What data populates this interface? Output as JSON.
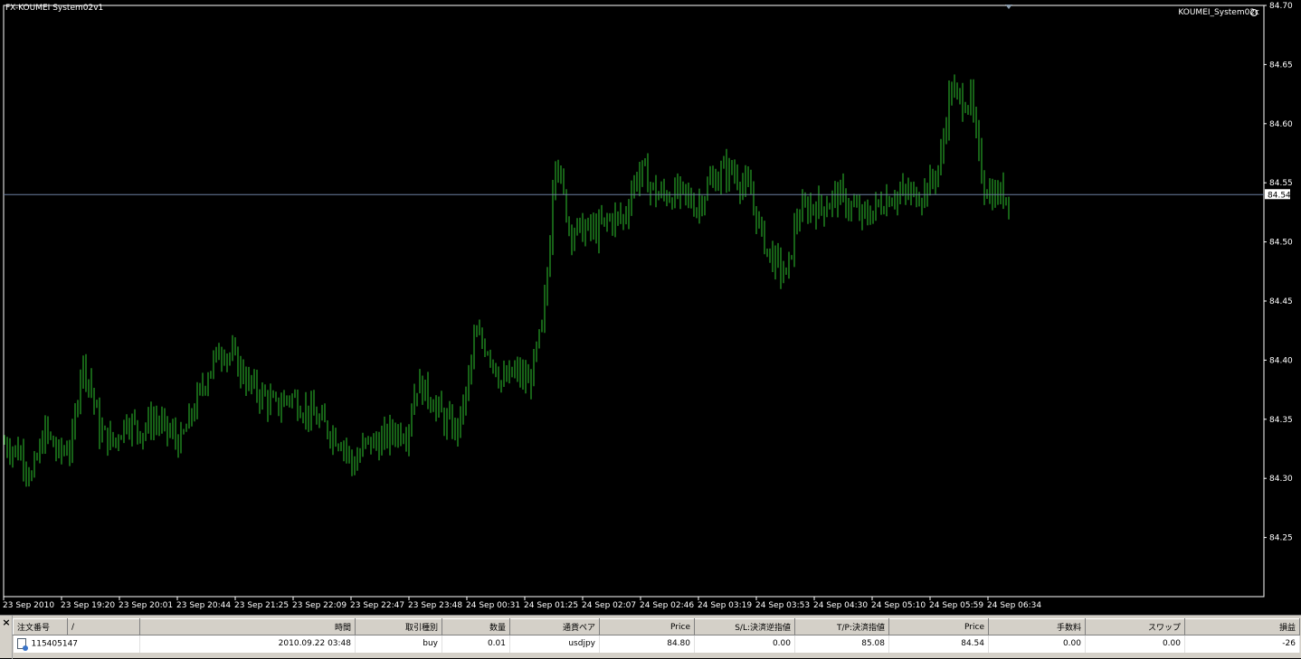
{
  "chart": {
    "title": "FX-KOUMEI System02v1",
    "indicator_label": "KOUMEI_System02c",
    "current_price_label": "84.54",
    "colors": {
      "bars": "#2ec52e",
      "axis": "#ffffff",
      "price_line": "#6c7f9f",
      "background": "#000000"
    }
  },
  "chart_data": {
    "type": "ohlc-bar",
    "symbol_hint": "usdjpy",
    "x_tick_labels": [
      "23 Sep 2010",
      "23 Sep 19:20",
      "23 Sep 20:01",
      "23 Sep 20:44",
      "23 Sep 21:25",
      "23 Sep 22:09",
      "23 Sep 22:47",
      "23 Sep 23:48",
      "24 Sep 00:31",
      "24 Sep 01:25",
      "24 Sep 02:07",
      "24 Sep 02:46",
      "24 Sep 03:19",
      "24 Sep 03:53",
      "24 Sep 04:30",
      "24 Sep 05:10",
      "24 Sep 05:59",
      "24 Sep 06:34"
    ],
    "y_tick_labels": [
      "84.70",
      "84.65",
      "84.60",
      "84.55",
      "84.50",
      "84.45",
      "84.40",
      "84.35",
      "84.30",
      "84.25"
    ],
    "ylim": [
      84.2,
      84.7
    ],
    "current_price": 84.54,
    "price_path": [
      [
        0,
        84.33
      ],
      [
        20,
        84.32
      ],
      [
        30,
        84.3
      ],
      [
        45,
        84.34
      ],
      [
        60,
        84.32
      ],
      [
        75,
        84.33
      ],
      [
        85,
        84.4
      ],
      [
        95,
        84.38
      ],
      [
        105,
        84.34
      ],
      [
        120,
        84.33
      ],
      [
        135,
        84.35
      ],
      [
        150,
        84.34
      ],
      [
        165,
        84.35
      ],
      [
        180,
        84.34
      ],
      [
        195,
        84.33
      ],
      [
        210,
        84.36
      ],
      [
        225,
        84.39
      ],
      [
        240,
        84.41
      ],
      [
        255,
        84.4
      ],
      [
        270,
        84.38
      ],
      [
        285,
        84.37
      ],
      [
        300,
        84.36
      ],
      [
        315,
        84.37
      ],
      [
        330,
        84.36
      ],
      [
        345,
        84.35
      ],
      [
        360,
        84.34
      ],
      [
        375,
        84.33
      ],
      [
        385,
        84.31
      ],
      [
        400,
        84.33
      ],
      [
        415,
        84.33
      ],
      [
        430,
        84.34
      ],
      [
        445,
        84.34
      ],
      [
        455,
        84.38
      ],
      [
        470,
        84.37
      ],
      [
        485,
        84.35
      ],
      [
        500,
        84.34
      ],
      [
        510,
        84.37
      ],
      [
        520,
        84.42
      ],
      [
        535,
        84.41
      ],
      [
        550,
        84.38
      ],
      [
        565,
        84.39
      ],
      [
        580,
        84.38
      ],
      [
        595,
        84.43
      ],
      [
        602,
        84.49
      ],
      [
        608,
        84.58
      ],
      [
        615,
        84.55
      ],
      [
        625,
        84.51
      ],
      [
        640,
        84.51
      ],
      [
        655,
        84.51
      ],
      [
        670,
        84.52
      ],
      [
        685,
        84.52
      ],
      [
        695,
        84.55
      ],
      [
        705,
        84.56
      ],
      [
        720,
        84.54
      ],
      [
        735,
        84.54
      ],
      [
        750,
        84.54
      ],
      [
        765,
        84.53
      ],
      [
        780,
        84.55
      ],
      [
        795,
        84.56
      ],
      [
        805,
        84.56
      ],
      [
        815,
        84.55
      ],
      [
        825,
        84.54
      ],
      [
        835,
        84.51
      ],
      [
        845,
        84.49
      ],
      [
        855,
        84.48
      ],
      [
        865,
        84.47
      ],
      [
        875,
        84.52
      ],
      [
        890,
        84.53
      ],
      [
        905,
        84.53
      ],
      [
        920,
        84.54
      ],
      [
        935,
        84.53
      ],
      [
        950,
        84.52
      ],
      [
        965,
        84.53
      ],
      [
        980,
        84.54
      ],
      [
        995,
        84.54
      ],
      [
        1010,
        84.54
      ],
      [
        1025,
        84.55
      ],
      [
        1035,
        84.57
      ],
      [
        1045,
        84.63
      ],
      [
        1055,
        84.62
      ],
      [
        1068,
        84.62
      ],
      [
        1075,
        84.58
      ],
      [
        1082,
        84.55
      ],
      [
        1090,
        84.54
      ],
      [
        1100,
        84.54
      ],
      [
        1112,
        84.54
      ]
    ]
  },
  "orders_table": {
    "columns": [
      "注文番号",
      "/",
      "時間",
      "取引種別",
      "数量",
      "通貨ペア",
      "Price",
      "S/L:決済逆指値",
      "T/P:決済指値",
      "Price",
      "手数料",
      "スワップ",
      "損益"
    ],
    "rows": [
      [
        "115405147",
        "",
        "2010.09.22 03:48",
        "buy",
        "0.01",
        "usdjpy",
        "84.80",
        "0.00",
        "85.08",
        "84.54",
        "0.00",
        "0.00",
        "-26"
      ]
    ]
  }
}
